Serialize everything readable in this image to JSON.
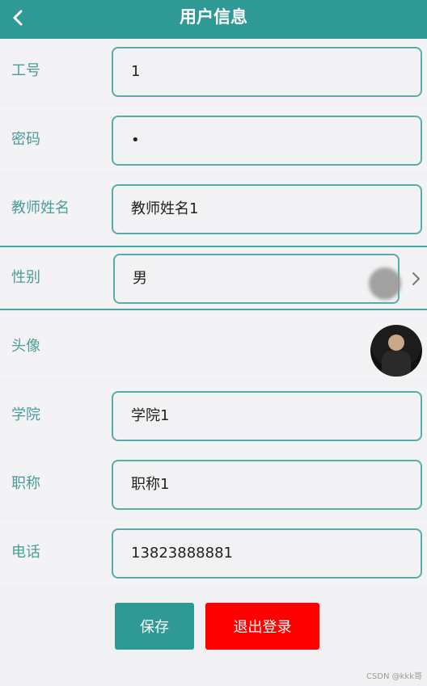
{
  "header": {
    "title": "用户信息",
    "back_icon": "chevron-left-icon"
  },
  "rows": [
    {
      "label": "工号",
      "value": "1"
    },
    {
      "label": "密码",
      "value": "•"
    },
    {
      "label": "教师姓名",
      "value": "教师姓名1"
    },
    {
      "label": "性别",
      "value": "男",
      "select_icon": "chevron-right-icon"
    },
    {
      "label": "头像",
      "avatar": "avatar-image"
    },
    {
      "label": "学院",
      "value": "学院1"
    },
    {
      "label": "职称",
      "value": "职称1"
    },
    {
      "label": "电话",
      "value": "13823888881"
    }
  ],
  "actions": {
    "save_label": "保存",
    "logout_label": "退出登录"
  },
  "watermark": "CSDN @kkk哥",
  "colors": {
    "primary": "#2f9a95",
    "danger": "#ff0000",
    "label": "#4b9d98"
  }
}
